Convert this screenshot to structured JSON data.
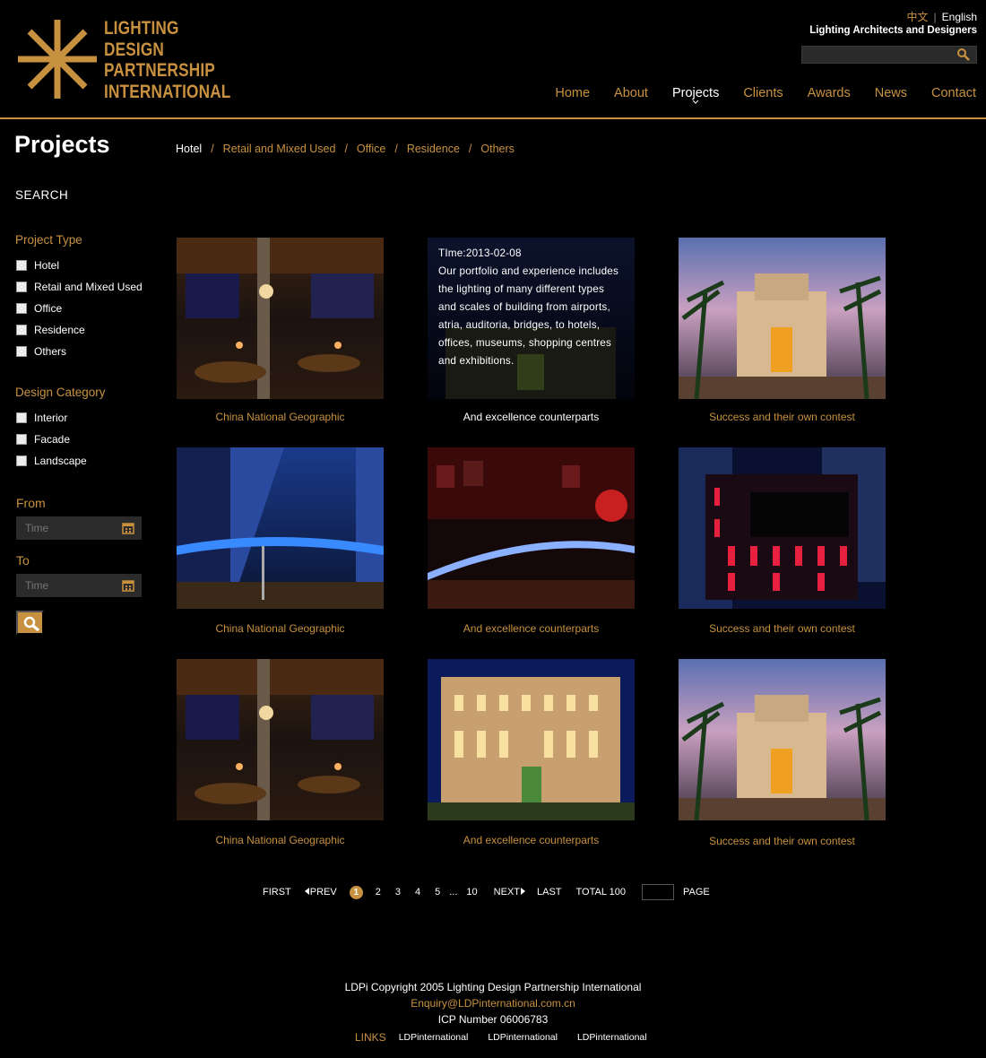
{
  "brand": {
    "logo_lines": [
      "LIGHTING",
      "DESIGN",
      "PARTNERSHIP",
      "INTERNATIONAL"
    ],
    "tagline": "Lighting Architects and Designers",
    "accent_color": "#c8913f"
  },
  "lang": {
    "cn": "中文",
    "sep": "|",
    "en": "English"
  },
  "search": {
    "placeholder": ""
  },
  "nav": [
    "Home",
    "About",
    "Projects",
    "Clients",
    "Awards",
    "News",
    "Contact"
  ],
  "nav_active": "Projects",
  "page_title": "Projects",
  "sidebar": {
    "search_label": "SEARCH",
    "project_type": {
      "title": "Project Type",
      "options": [
        "Hotel",
        "Retail and Mixed Used",
        "Office",
        "Residence",
        "Others"
      ]
    },
    "design_category": {
      "title": "Design Category",
      "options": [
        "Interior",
        "Facade",
        "Landscape"
      ]
    },
    "from_label": "From",
    "to_label": "To",
    "from_placeholder": "Time",
    "to_placeholder": "Time"
  },
  "filters": [
    "Hotel",
    "Retail and Mixed Used",
    "Office",
    "Residence",
    "Others"
  ],
  "filters_sep": "/",
  "projects": [
    {
      "caption": "China National Geographic",
      "image": "restaurant-interior"
    },
    {
      "caption": "And excellence counterparts",
      "image": "hover-overlay",
      "overlay_date": "TIme:2013-02-08",
      "overlay_text": "Our portfolio and experience includes the lighting of many different types and scales of building from airports, atria, auditoria, bridges, to hotels, offices, museums, shopping centres and exhibitions."
    },
    {
      "caption": "Success and their own contest",
      "image": "palace-entrance"
    },
    {
      "caption": "China National Geographic",
      "image": "curved-tower"
    },
    {
      "caption": "And excellence counterparts",
      "image": "red-bar"
    },
    {
      "caption": "Success and their own contest",
      "image": "red-facade"
    },
    {
      "caption": "China National Geographic",
      "image": "restaurant-interior"
    },
    {
      "caption": "And excellence counterparts",
      "image": "hotel-facade"
    },
    {
      "caption": "Success and their own contest",
      "image": "palace-entrance"
    }
  ],
  "pager": {
    "first": "FIRST",
    "prev": "PREV",
    "current": "1",
    "pages": [
      "2",
      "3",
      "4",
      "5"
    ],
    "ellipsis": "...",
    "last_page": "10",
    "next": "NEXT",
    "last": "LAST",
    "total": "TOTAL 100",
    "page_label": "PAGE"
  },
  "footer": {
    "copyright": "LDPi Copyright 2005 Lighting Design Partnership International",
    "email": "Enquiry@LDPinternational.com.cn",
    "icp": "ICP Number 06006783",
    "links_label": "LINKS",
    "links": [
      "LDPinternational",
      "LDPinternational",
      "LDPinternational"
    ]
  }
}
